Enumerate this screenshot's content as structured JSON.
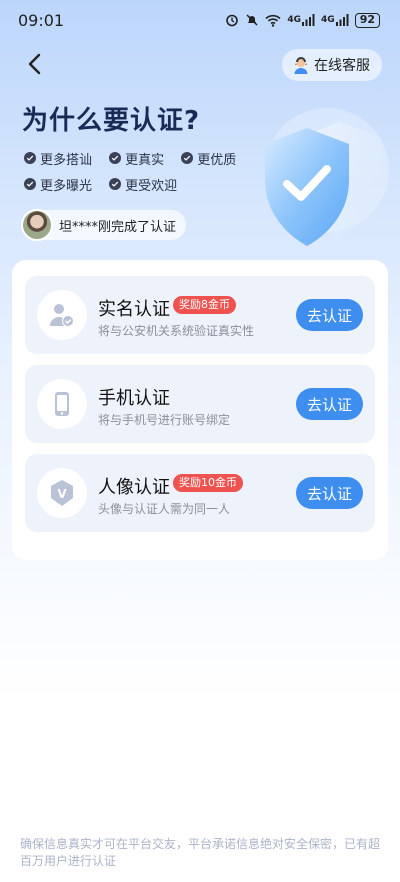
{
  "status_bar": {
    "time": "09:01",
    "signal_1": "4G",
    "signal_2": "4G",
    "battery": "92"
  },
  "header": {
    "service_label": "在线客服"
  },
  "hero": {
    "title": "为什么要认证?",
    "perks": [
      "更多搭讪",
      "更真实",
      "更优质",
      "更多曝光",
      "更受欢迎"
    ],
    "recent_text": "坦****刚完成了认证"
  },
  "cards": [
    {
      "title": "实名认证",
      "reward": "奖励8金币",
      "description": "将与公安机关系统验证真实性",
      "button": "去认证",
      "icon": "id-person-icon"
    },
    {
      "title": "手机认证",
      "reward": "",
      "description": "将与手机号进行账号绑定",
      "button": "去认证",
      "icon": "phone-icon"
    },
    {
      "title": "人像认证",
      "reward": "奖励10金币",
      "description": "头像与认证人需为同一人",
      "button": "去认证",
      "icon": "v-badge-icon"
    }
  ],
  "footer": {
    "note": "确保信息真实才可在平台交友，平台承诺信息绝对安全保密，已有超百万用户进行认证"
  },
  "colors": {
    "accent": "#3e8ef0",
    "reward": "#ef5350",
    "title": "#1a2a56"
  }
}
